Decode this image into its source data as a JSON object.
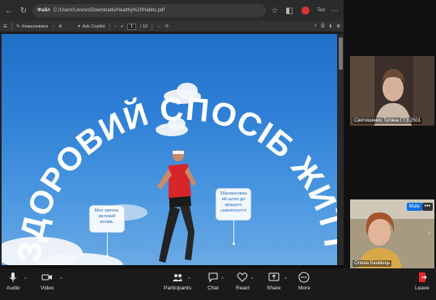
{
  "browser": {
    "file_label": "Файл",
    "path": "C:/Users/Lenovo/Downloads/Healthy%20Habits.pdf",
    "profile_initials": "Ted"
  },
  "pdf_toolbar": {
    "read_aloud": "Ask Copilot",
    "draw": "Намалювати",
    "page_current": "1",
    "page_total": "/ 10"
  },
  "slide": {
    "arc_title": "ЗДОРОВИЙ СПОСІБ ЖИТТЯ",
    "bubble_left": "Мал звички, великий вплив.",
    "bubble_right": "Збалансован ий шлях до кращого самопочуття"
  },
  "participants": [
    {
      "name": "Святишенко Тетяна ГТЗ 2501"
    },
    {
      "name": "Олена Канівець",
      "mute_label": "Mute",
      "more_label": "•••"
    }
  ],
  "zoom_bar": {
    "audio": "Audio",
    "video": "Video",
    "participants": "Participants",
    "participants_count": "5",
    "chat": "Chat",
    "react": "React",
    "share": "Share",
    "more": "More",
    "leave": "Leave"
  },
  "colors": {
    "accent": "#0e72ed",
    "leave": "#e02828",
    "sky": "#2f80d6"
  }
}
